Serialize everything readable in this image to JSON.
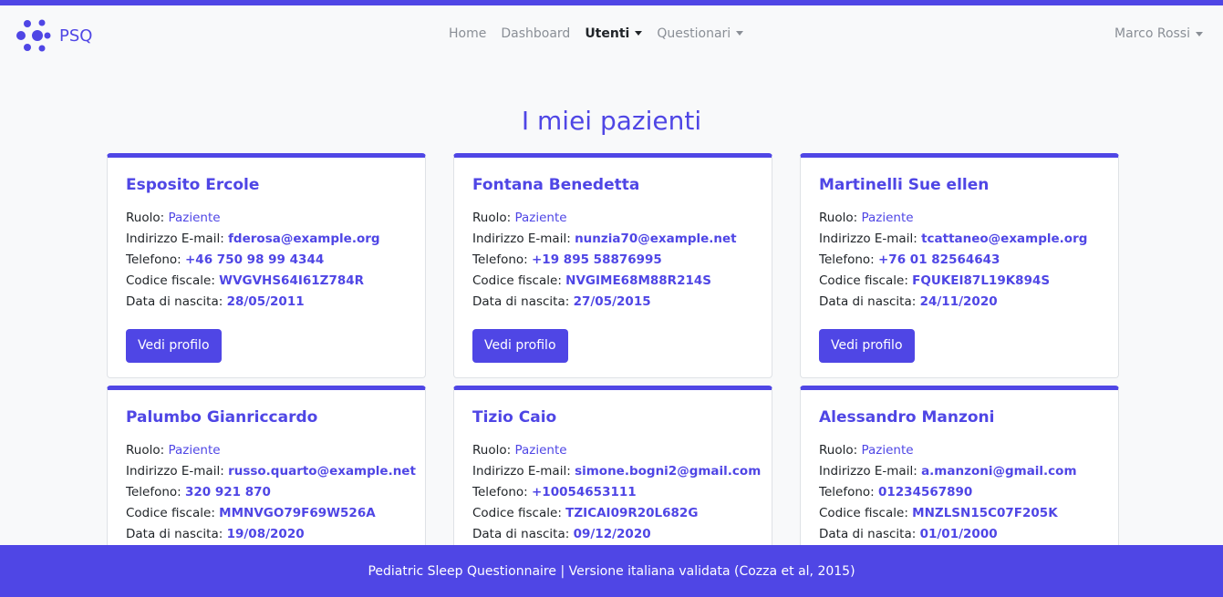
{
  "brand": {
    "name": "PSQ"
  },
  "nav": {
    "items": [
      {
        "label": "Home",
        "active": false,
        "dropdown": false
      },
      {
        "label": "Dashboard",
        "active": false,
        "dropdown": false
      },
      {
        "label": "Utenti",
        "active": true,
        "dropdown": true
      },
      {
        "label": "Questionari",
        "active": false,
        "dropdown": true
      }
    ],
    "user": "Marco Rossi"
  },
  "main": {
    "title": "I miei pazienti",
    "labels": {
      "role": "Ruolo:",
      "email": "Indirizzo E-mail:",
      "phone": "Telefono:",
      "tax_code": "Codice fiscale:",
      "birth_date": "Data di nascita:",
      "button": "Vedi profilo"
    },
    "patients": [
      {
        "name": "Esposito Ercole",
        "role": "Paziente",
        "email": "fderosa@example.org",
        "phone": "+46 750 98 99 4344",
        "tax_code": "WVGVHS64I61Z784R",
        "birth_date": "28/05/2011"
      },
      {
        "name": "Fontana Benedetta",
        "role": "Paziente",
        "email": "nunzia70@example.net",
        "phone": "+19 895 58876995",
        "tax_code": "NVGIME68M88R214S",
        "birth_date": "27/05/2015"
      },
      {
        "name": "Martinelli Sue ellen",
        "role": "Paziente",
        "email": "tcattaneo@example.org",
        "phone": "+76 01 82564643",
        "tax_code": "FQUKEI87L19K894S",
        "birth_date": "24/11/2020"
      },
      {
        "name": "Palumbo Gianriccardo",
        "role": "Paziente",
        "email": "russo.quarto@example.net",
        "phone": "320 921 870",
        "tax_code": "MMNVGO79F69W526A",
        "birth_date": "19/08/2020"
      },
      {
        "name": "Tizio Caio",
        "role": "Paziente",
        "email": "simone.bogni2@gmail.com",
        "phone": "+10054653111",
        "tax_code": "TZICAI09R20L682G",
        "birth_date": "09/12/2020"
      },
      {
        "name": "Alessandro Manzoni",
        "role": "Paziente",
        "email": "a.manzoni@gmail.com",
        "phone": "01234567890",
        "tax_code": "MNZLSN15C07F205K",
        "birth_date": "01/01/2000"
      }
    ]
  },
  "footer": {
    "text": "Pediatric Sleep Questionnaire | Versione italiana validata (Cozza et al, 2015)"
  },
  "colors": {
    "accent": "#4f46e5",
    "background": "#f8f9fa"
  },
  "icons": {
    "logo": "psq-logo-icon",
    "dropdown": "caret-down-icon"
  }
}
